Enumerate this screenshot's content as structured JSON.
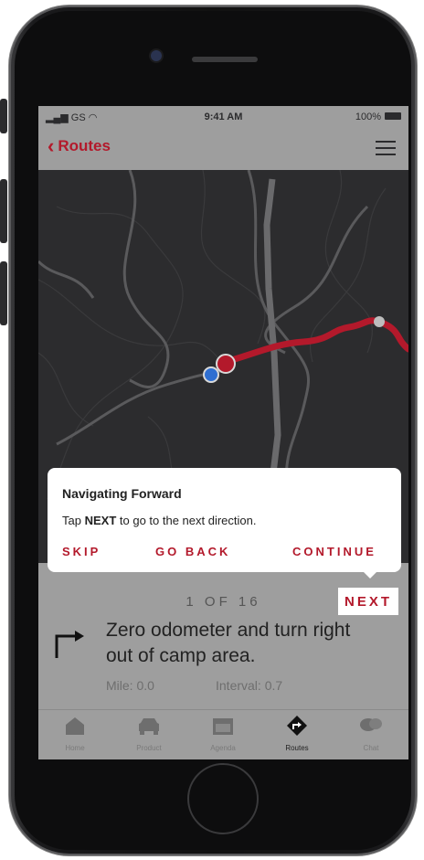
{
  "status_bar": {
    "carrier": "GS",
    "time": "9:41 AM",
    "battery": "100%"
  },
  "nav": {
    "back_label": "Routes"
  },
  "tooltip": {
    "title": "Navigating Forward",
    "body_prefix": "Tap",
    "body_bold": "NEXT",
    "body_suffix": "to go to the next direction.",
    "skip": "SKIP",
    "go_back": "GO BACK",
    "continue": "CONTINUE"
  },
  "direction": {
    "counter": "1 OF 16",
    "next": "NEXT",
    "instruction": "Zero odometer and turn right out of camp area.",
    "mile": "Mile: 0.0",
    "interval": "Interval: 0.7"
  },
  "tabs": [
    {
      "label": "Home",
      "icon": "home-icon",
      "active": false
    },
    {
      "label": "Product",
      "icon": "car-icon",
      "active": false
    },
    {
      "label": "Agenda",
      "icon": "calendar-icon",
      "active": false
    },
    {
      "label": "Routes",
      "icon": "route-icon",
      "active": true
    },
    {
      "label": "Chat",
      "icon": "chat-icon",
      "active": false
    }
  ],
  "colors": {
    "accent": "#b3192b",
    "panel": "#9e9e9e",
    "map_bg": "#2c2c2e"
  }
}
